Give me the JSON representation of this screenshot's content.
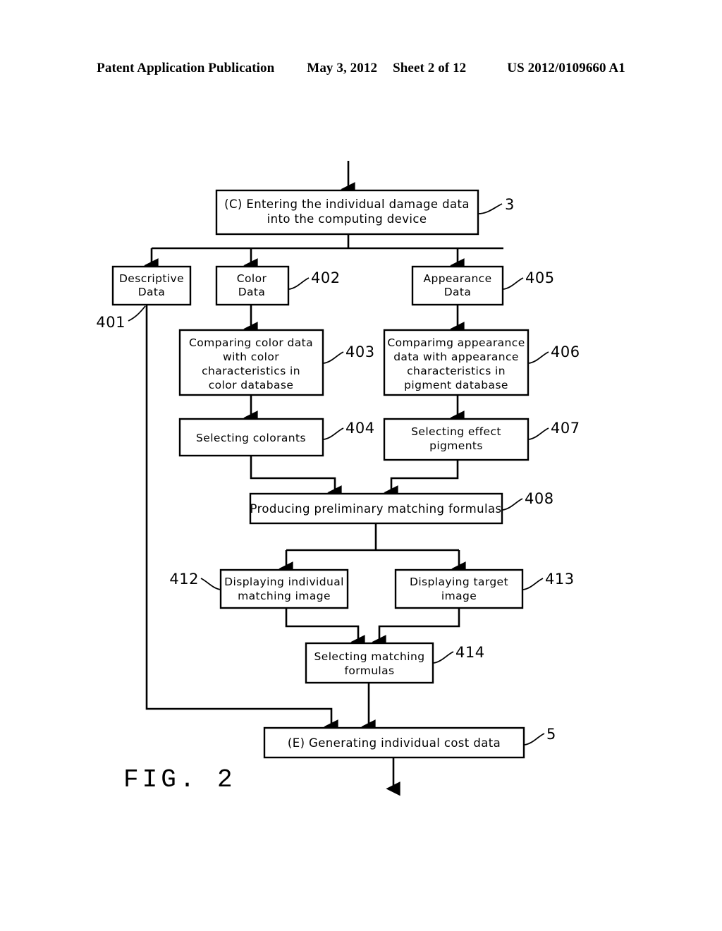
{
  "header": {
    "publication": "Patent Application Publication",
    "date": "May 3, 2012",
    "sheet": "Sheet 2 of 12",
    "docnumber": "US 2012/0109660 A1"
  },
  "figure": {
    "caption": "FIG. 2",
    "title": "Flowchart of individual damage data processing and cost generation"
  },
  "nodes": {
    "c_entering": {
      "ref": "3",
      "line1": "(C)  Entering  the  individual damage  data",
      "line2": "into  the  computing  device"
    },
    "descriptive_data": {
      "ref": "401",
      "line1": "Descriptive",
      "line2": "Data"
    },
    "color_data": {
      "ref": "402",
      "line1": "Color",
      "line2": "Data"
    },
    "appearance_data": {
      "ref": "405",
      "line1": "Appearance",
      "line2": "Data"
    },
    "comparing_color": {
      "ref": "403",
      "line1": "Comparing  color  data",
      "line2": "with  color",
      "line3": "characteristics  in",
      "line4": "color  database"
    },
    "comparing_appearance": {
      "ref": "406",
      "line1": "Comparimg  appearance",
      "line2": "data  with  appearance",
      "line3": "characteristics  in",
      "line4": "pigment  database"
    },
    "selecting_colorants": {
      "ref": "404",
      "line1": "Selecting  colorants"
    },
    "selecting_effect_pigments": {
      "ref": "407",
      "line1": "Selecting  effect",
      "line2": "pigments"
    },
    "producing_formulas": {
      "ref": "408",
      "line1": "Producing  preliminary  matching  formulas"
    },
    "displaying_individual": {
      "ref": "412",
      "line1": "Displaying  individual",
      "line2": "matching  image"
    },
    "displaying_target": {
      "ref": "413",
      "line1": "Displaying  target",
      "line2": "image"
    },
    "selecting_matching": {
      "ref": "414",
      "line1": "Selecting  matching",
      "line2": "formulas"
    },
    "e_generating": {
      "ref": "5",
      "line1": "(E)   Generating  individual cost  data"
    }
  },
  "colors": {
    "ink": "#000000",
    "paper": "#ffffff"
  }
}
